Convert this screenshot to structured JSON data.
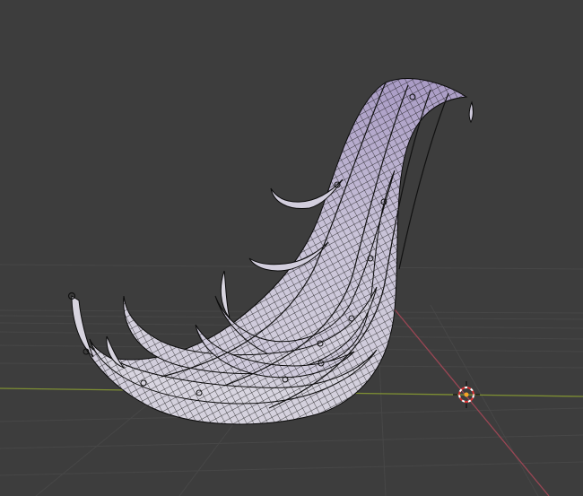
{
  "viewport": {
    "background": "#3d3d3d",
    "grid_color": "#454545",
    "x_axis_color": "#8a9a3a",
    "y_axis_color": "#9a4a55",
    "mesh_fill": "#c7c1d6",
    "mesh_fill_top": "#a99bc5",
    "wire_color": "#0d0d0d"
  },
  "objects": [
    {
      "name": "hair-strand-mesh",
      "mode": "wireframe-overlay"
    },
    {
      "name": "3d-cursor"
    },
    {
      "name": "origin-point"
    }
  ]
}
